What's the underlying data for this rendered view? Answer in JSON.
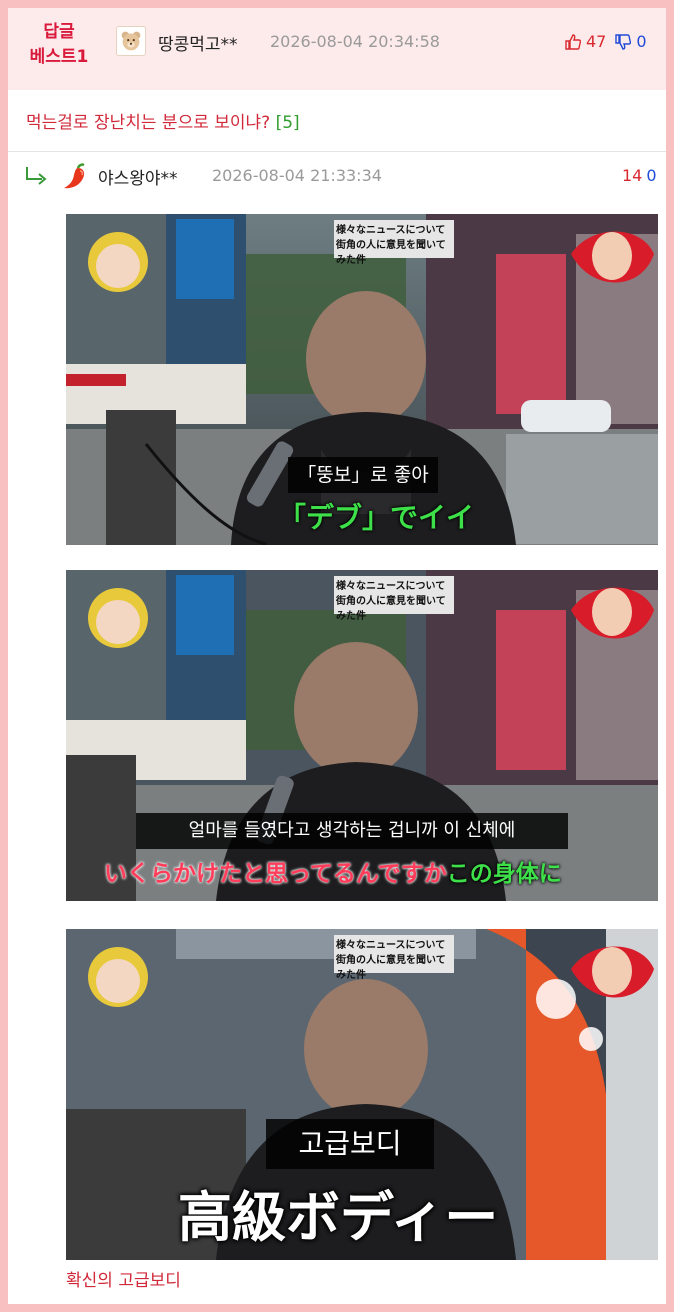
{
  "best_comment": {
    "badge_line1": "답글",
    "badge_line2": "베스트1",
    "author": "땅콩먹고**",
    "datetime": "2026-08-04 20:34:58",
    "upvotes": "47",
    "downvotes": "0",
    "text": "먹는걸로 장난치는 분으로 보이냐?",
    "reply_count": "[5]"
  },
  "reply": {
    "author": "야스왕야**",
    "datetime": "2026-08-04 21:33:34",
    "upvotes": "14",
    "downvotes": "0",
    "caption": "확신의 고급보디"
  },
  "panels": [
    {
      "header_line1": "様々なニュースについて",
      "header_line2": "街角の人に意見を聞いてみた件",
      "sub_korean": "「뚱보」로 좋아",
      "sub_japanese": "「デブ」でイイ",
      "sub_japanese_color": "#3ee04a"
    },
    {
      "header_line1": "様々なニュースについて",
      "header_line2": "街角の人に意見を聞いてみた件",
      "sub_korean": "얼마를 들였다고 생각하는 겁니까 이 신체에",
      "sub_japanese_a": "いくらかけたと思ってるんですか",
      "sub_japanese_b": "この身体に",
      "sub_japanese_a_color": "#ff3c5a",
      "sub_japanese_b_color": "#3ee04a"
    },
    {
      "header_line1": "様々なニュースについて",
      "header_line2": "街角の人に意見を聞いてみた件",
      "sub_korean": "고급보디",
      "sub_japanese": "高級ボディー",
      "sub_japanese_color": "#ffffff"
    }
  ],
  "icons": {
    "thumbs_up": "thumbs-up-icon",
    "thumbs_down": "thumbs-down-icon",
    "reply_arrow": "reply-arrow-icon",
    "bear_avatar": "bear-avatar-icon",
    "pepper_avatar": "chili-pepper-icon"
  }
}
